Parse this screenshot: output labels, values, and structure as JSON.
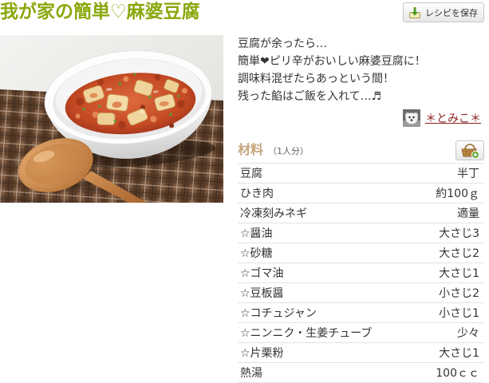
{
  "recipe": {
    "title": "我が家の簡単♡麻婆豆腐",
    "save_button_label": "レシピを保存",
    "description_lines": [
      "豆腐が余ったら…",
      "簡単❤ピリ辛がおいしい麻婆豆腐に！",
      "調味料混ぜたらあっという間！",
      "残った餡はご飯を入れて…♬"
    ],
    "author": {
      "name": "＊とみこ＊"
    },
    "ingredients": {
      "heading": "材料",
      "servings": "（1人分）",
      "items": [
        {
          "name": "豆腐",
          "quantity": "半丁"
        },
        {
          "name": "ひき肉",
          "quantity": "約100ｇ"
        },
        {
          "name": "冷凍刻みネギ",
          "quantity": "適量"
        },
        {
          "name": "☆醤油",
          "quantity": "大さじ3"
        },
        {
          "name": "☆砂糖",
          "quantity": "大さじ2"
        },
        {
          "name": "☆ゴマ油",
          "quantity": "大さじ1"
        },
        {
          "name": "☆豆板醤",
          "quantity": "小さじ2"
        },
        {
          "name": "☆コチュジャン",
          "quantity": "小さじ1"
        },
        {
          "name": "☆ニンニク・生姜チューブ",
          "quantity": "少々"
        },
        {
          "name": "☆片栗粉",
          "quantity": "大さじ1"
        },
        {
          "name": "熱湯",
          "quantity": "100ｃｃ"
        }
      ]
    }
  },
  "icons": {
    "save_button": "download-icon",
    "add_to_shopping_list": "shopping-basket-icon",
    "author_avatar": "avatar"
  },
  "colors": {
    "title": "#8aa80c",
    "ingredients_heading": "#c4a57c",
    "author_link": "#8f2222",
    "text": "#333333",
    "row_border": "#e3e3e3"
  }
}
